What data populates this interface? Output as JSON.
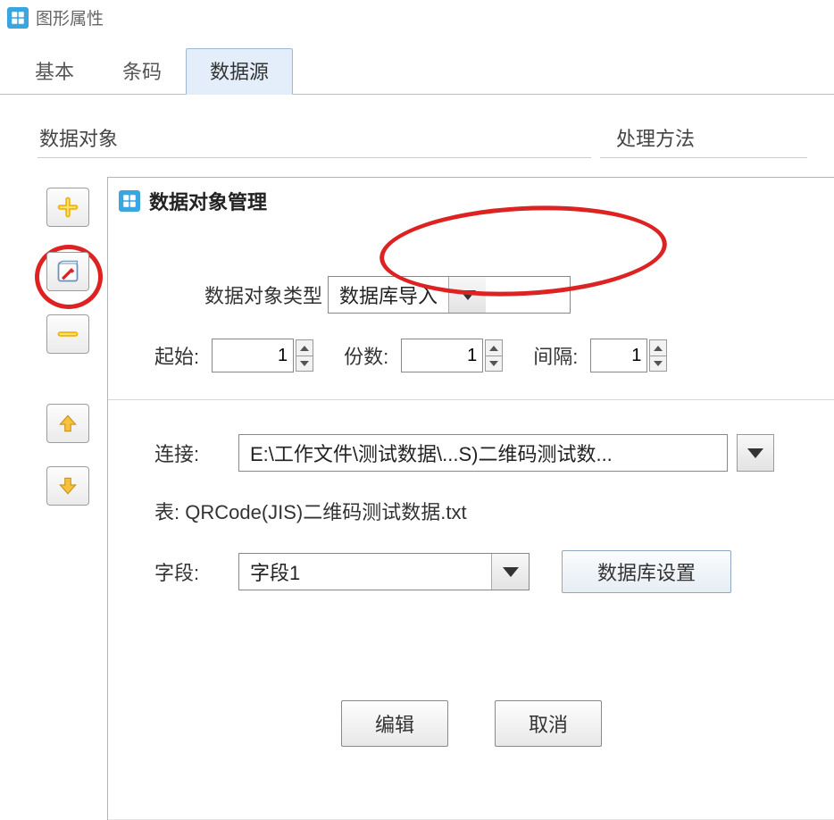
{
  "window": {
    "title": "图形属性"
  },
  "tabs": {
    "basic": "基本",
    "barcode": "条码",
    "datasource": "数据源"
  },
  "sections": {
    "data_objects": "数据对象",
    "process_methods": "处理方法"
  },
  "dialog": {
    "title": "数据对象管理",
    "type_label": "数据对象类型",
    "type_value": "数据库导入",
    "start_label": "起始:",
    "start_value": "1",
    "copies_label": "份数:",
    "copies_value": "1",
    "interval_label": "间隔:",
    "interval_value": "1",
    "connect_label": "连接:",
    "connect_value": "E:\\工作文件\\测试数据\\...S)二维码测试数...",
    "table_label": "表:  QRCode(JIS)二维码测试数据.txt",
    "field_label": "字段:",
    "field_value": "字段1",
    "db_settings_btn": "数据库设置",
    "edit_btn": "编辑",
    "cancel_btn": "取消"
  },
  "icons": {
    "add": "add-icon",
    "edit": "edit-icon",
    "remove": "remove-icon",
    "up": "arrow-up-icon",
    "down": "arrow-down-icon"
  }
}
